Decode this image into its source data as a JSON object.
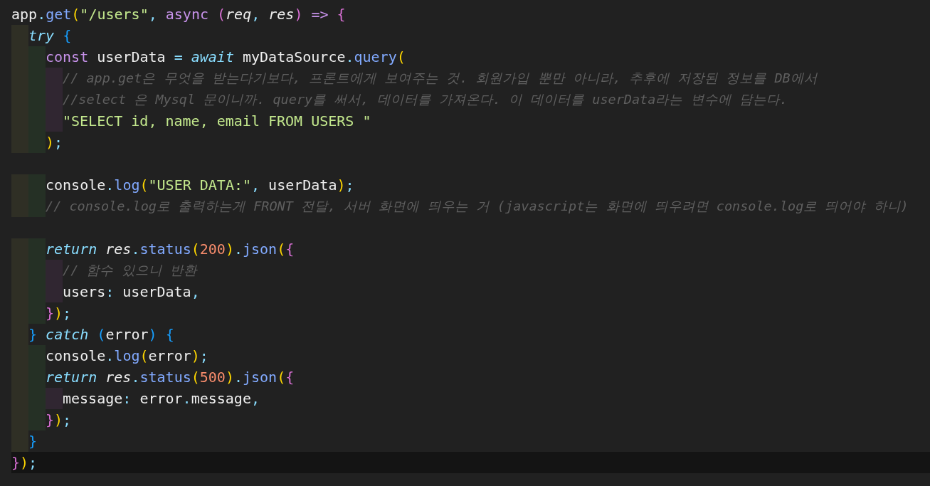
{
  "editor": {
    "lines": [
      {
        "current": false,
        "tokens": [
          {
            "kind": "plain",
            "text": "app"
          },
          {
            "kind": "punct",
            "text": "."
          },
          {
            "kind": "func",
            "text": "get"
          },
          {
            "kind": "b1",
            "text": "("
          },
          {
            "kind": "string",
            "text": "\"/users\""
          },
          {
            "kind": "punct",
            "text": ","
          },
          {
            "kind": "keyword",
            "text": " async"
          },
          {
            "kind": "b2",
            "text": " ("
          },
          {
            "kind": "param",
            "text": "req"
          },
          {
            "kind": "punct",
            "text": ","
          },
          {
            "kind": "param",
            "text": " res"
          },
          {
            "kind": "b2",
            "text": ")"
          },
          {
            "kind": "keyword",
            "text": " =>"
          },
          {
            "kind": "b2",
            "text": " {"
          }
        ]
      },
      {
        "current": false,
        "guides": [
          {
            "color": "#2f2f25"
          }
        ],
        "tokens": [
          {
            "kind": "control",
            "text": "try"
          },
          {
            "kind": "b3",
            "text": " {"
          }
        ]
      },
      {
        "current": false,
        "guides": [
          {
            "color": "#2f2f25"
          },
          {
            "color": "#253025"
          }
        ],
        "tokens": [
          {
            "kind": "keyword",
            "text": "const"
          },
          {
            "kind": "plain",
            "text": " userData "
          },
          {
            "kind": "punct",
            "text": "="
          },
          {
            "kind": "control",
            "text": " await"
          },
          {
            "kind": "plain",
            "text": " myDataSource"
          },
          {
            "kind": "punct",
            "text": "."
          },
          {
            "kind": "func",
            "text": "query"
          },
          {
            "kind": "b1",
            "text": "("
          }
        ]
      },
      {
        "current": false,
        "guides": [
          {
            "color": "#2f2f25"
          },
          {
            "color": "#253025"
          },
          {
            "color": "#302631"
          }
        ],
        "tokens": [
          {
            "kind": "comment",
            "text": "// app.get은 무엇을 받는다기보다, 프론트에게 보여주는 것. 회원가입 뿐만 아니라, 추후에 저장된 정보를 DB에서"
          }
        ]
      },
      {
        "current": false,
        "guides": [
          {
            "color": "#2f2f25"
          },
          {
            "color": "#253025"
          },
          {
            "color": "#302631"
          }
        ],
        "tokens": [
          {
            "kind": "comment",
            "text": "//select 은 Mysql 문이니까. query를 써서, 데이터를 가져온다. 이 데이터를 userData라는 변수에 담는다."
          }
        ]
      },
      {
        "current": false,
        "guides": [
          {
            "color": "#2f2f25"
          },
          {
            "color": "#253025"
          },
          {
            "color": "#302631"
          }
        ],
        "tokens": [
          {
            "kind": "string",
            "text": "\"SELECT id, name, email FROM USERS \""
          }
        ]
      },
      {
        "current": false,
        "guides": [
          {
            "color": "#2f2f25"
          },
          {
            "color": "#253025"
          }
        ],
        "tokens": [
          {
            "kind": "b1",
            "text": ")"
          },
          {
            "kind": "punct",
            "text": ";"
          }
        ]
      },
      {
        "current": false
      },
      {
        "current": false,
        "guides": [
          {
            "color": "#2f2f25"
          },
          {
            "color": "#253025"
          }
        ],
        "tokens": [
          {
            "kind": "plain",
            "text": "console"
          },
          {
            "kind": "punct",
            "text": "."
          },
          {
            "kind": "func",
            "text": "log"
          },
          {
            "kind": "b1",
            "text": "("
          },
          {
            "kind": "string",
            "text": "\"USER DATA:\""
          },
          {
            "kind": "punct",
            "text": ","
          },
          {
            "kind": "plain",
            "text": " userData"
          },
          {
            "kind": "b1",
            "text": ")"
          },
          {
            "kind": "punct",
            "text": ";"
          }
        ]
      },
      {
        "current": false,
        "guides": [
          {
            "color": "#2f2f25"
          },
          {
            "color": "#253025"
          }
        ],
        "tokens": [
          {
            "kind": "comment",
            "text": "// console.log로 출력하는게 FRONT 전달, 서버 화면에 띄우는 거 (javascript는 화면에 띄우려면 console.log로 띄어야 하니)"
          }
        ]
      },
      {
        "current": false
      },
      {
        "current": false,
        "guides": [
          {
            "color": "#2f2f25"
          },
          {
            "color": "#253025"
          }
        ],
        "tokens": [
          {
            "kind": "control",
            "text": "return"
          },
          {
            "kind": "param",
            "text": " res"
          },
          {
            "kind": "punct",
            "text": "."
          },
          {
            "kind": "func",
            "text": "status"
          },
          {
            "kind": "b1",
            "text": "("
          },
          {
            "kind": "number",
            "text": "200"
          },
          {
            "kind": "b1",
            "text": ")"
          },
          {
            "kind": "punct",
            "text": "."
          },
          {
            "kind": "func",
            "text": "json"
          },
          {
            "kind": "b1",
            "text": "("
          },
          {
            "kind": "b2",
            "text": "{"
          }
        ]
      },
      {
        "current": false,
        "guides": [
          {
            "color": "#2f2f25"
          },
          {
            "color": "#253025"
          },
          {
            "color": "#302631"
          }
        ],
        "tokens": [
          {
            "kind": "comment",
            "text": "// 함수 있으니 반환"
          }
        ]
      },
      {
        "current": false,
        "guides": [
          {
            "color": "#2f2f25"
          },
          {
            "color": "#253025"
          },
          {
            "color": "#302631"
          }
        ],
        "tokens": [
          {
            "kind": "plain",
            "text": "users"
          },
          {
            "kind": "punct",
            "text": ":"
          },
          {
            "kind": "plain",
            "text": " userData"
          },
          {
            "kind": "punct",
            "text": ","
          }
        ]
      },
      {
        "current": false,
        "guides": [
          {
            "color": "#2f2f25"
          },
          {
            "color": "#253025"
          }
        ],
        "tokens": [
          {
            "kind": "b2",
            "text": "}"
          },
          {
            "kind": "b1",
            "text": ")"
          },
          {
            "kind": "punct",
            "text": ";"
          }
        ]
      },
      {
        "current": false,
        "guides": [
          {
            "color": "#2f2f25"
          }
        ],
        "tokens": [
          {
            "kind": "b3",
            "text": "}"
          },
          {
            "kind": "control",
            "text": " catch"
          },
          {
            "kind": "b3",
            "text": " ("
          },
          {
            "kind": "plain",
            "text": "error"
          },
          {
            "kind": "b3",
            "text": ")"
          },
          {
            "kind": "b3",
            "text": " {"
          }
        ]
      },
      {
        "current": false,
        "guides": [
          {
            "color": "#2f2f25"
          },
          {
            "color": "#253025"
          }
        ],
        "tokens": [
          {
            "kind": "plain",
            "text": "console"
          },
          {
            "kind": "punct",
            "text": "."
          },
          {
            "kind": "func",
            "text": "log"
          },
          {
            "kind": "b1",
            "text": "("
          },
          {
            "kind": "plain",
            "text": "error"
          },
          {
            "kind": "b1",
            "text": ")"
          },
          {
            "kind": "punct",
            "text": ";"
          }
        ]
      },
      {
        "current": false,
        "guides": [
          {
            "color": "#2f2f25"
          },
          {
            "color": "#253025"
          }
        ],
        "tokens": [
          {
            "kind": "control",
            "text": "return"
          },
          {
            "kind": "param",
            "text": " res"
          },
          {
            "kind": "punct",
            "text": "."
          },
          {
            "kind": "func",
            "text": "status"
          },
          {
            "kind": "b1",
            "text": "("
          },
          {
            "kind": "number",
            "text": "500"
          },
          {
            "kind": "b1",
            "text": ")"
          },
          {
            "kind": "punct",
            "text": "."
          },
          {
            "kind": "func",
            "text": "json"
          },
          {
            "kind": "b1",
            "text": "("
          },
          {
            "kind": "b2",
            "text": "{"
          }
        ]
      },
      {
        "current": false,
        "guides": [
          {
            "color": "#2f2f25"
          },
          {
            "color": "#253025"
          },
          {
            "color": "#302631"
          }
        ],
        "tokens": [
          {
            "kind": "plain",
            "text": "message"
          },
          {
            "kind": "punct",
            "text": ":"
          },
          {
            "kind": "plain",
            "text": " error"
          },
          {
            "kind": "punct",
            "text": "."
          },
          {
            "kind": "plain",
            "text": "message"
          },
          {
            "kind": "punct",
            "text": ","
          }
        ]
      },
      {
        "current": false,
        "guides": [
          {
            "color": "#2f2f25"
          },
          {
            "color": "#253025"
          }
        ],
        "tokens": [
          {
            "kind": "b2",
            "text": "}"
          },
          {
            "kind": "b1",
            "text": ")"
          },
          {
            "kind": "punct",
            "text": ";"
          }
        ]
      },
      {
        "current": false,
        "guides": [
          {
            "color": "#2f2f25"
          }
        ],
        "tokens": [
          {
            "kind": "b3",
            "text": "}"
          }
        ]
      },
      {
        "current": true,
        "tokens": [
          {
            "kind": "b2",
            "text": "}"
          },
          {
            "kind": "b1",
            "text": ")"
          },
          {
            "kind": "punct",
            "text": ";"
          }
        ]
      }
    ]
  }
}
